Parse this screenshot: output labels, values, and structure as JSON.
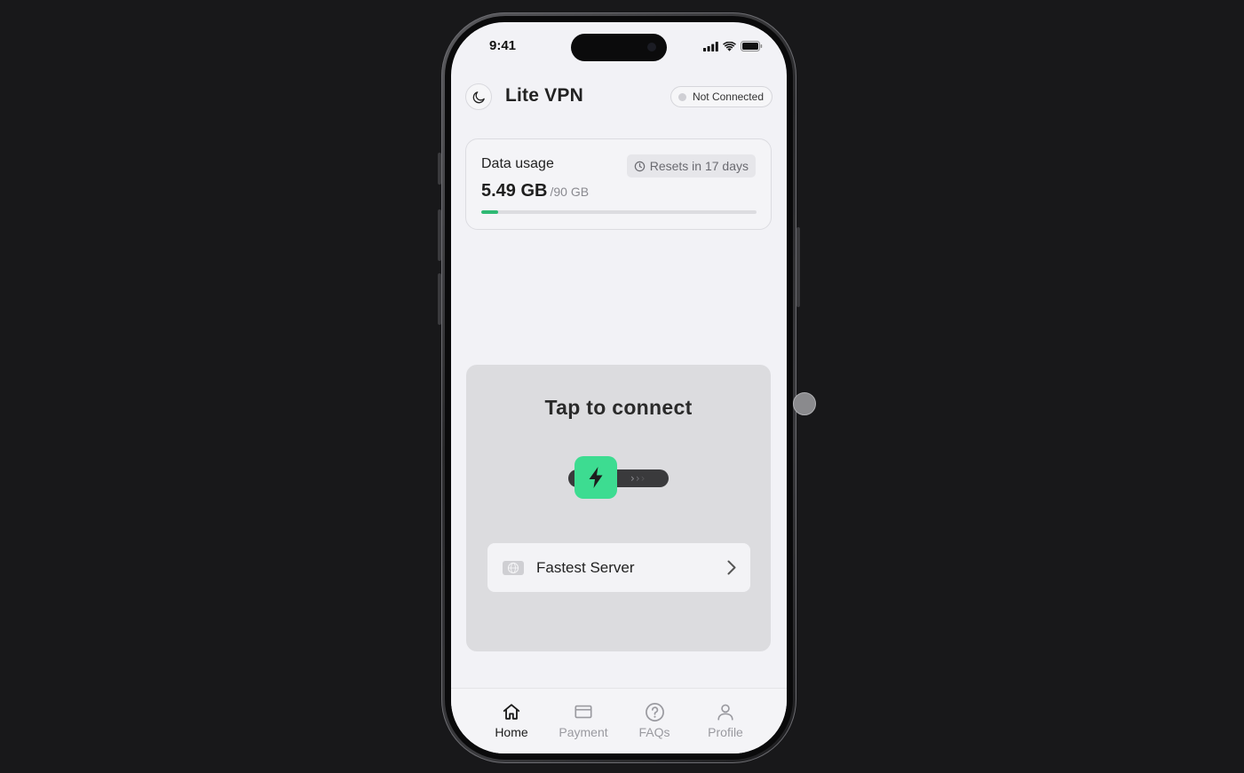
{
  "status_bar": {
    "time": "9:41"
  },
  "header": {
    "app_title": "Lite VPN",
    "connection_status": "Not Connected",
    "theme_icon": "moon-icon"
  },
  "data_usage": {
    "label": "Data usage",
    "reset_text": "Resets in 17 days",
    "used": "5.49 GB",
    "total": "/90 GB",
    "used_fraction": 0.061,
    "bar_color": "#2fb974"
  },
  "connect": {
    "title": "Tap to connect",
    "knob_icon": "lightning-bolt-icon",
    "knob_color": "#3ddc91",
    "server_label": "Fastest Server",
    "server_icon": "globe-icon"
  },
  "tabs": [
    {
      "label": "Home",
      "icon": "home-icon",
      "active": true
    },
    {
      "label": "Payment",
      "icon": "card-icon",
      "active": false
    },
    {
      "label": "FAQs",
      "icon": "question-icon",
      "active": false
    },
    {
      "label": "Profile",
      "icon": "user-icon",
      "active": false
    }
  ]
}
